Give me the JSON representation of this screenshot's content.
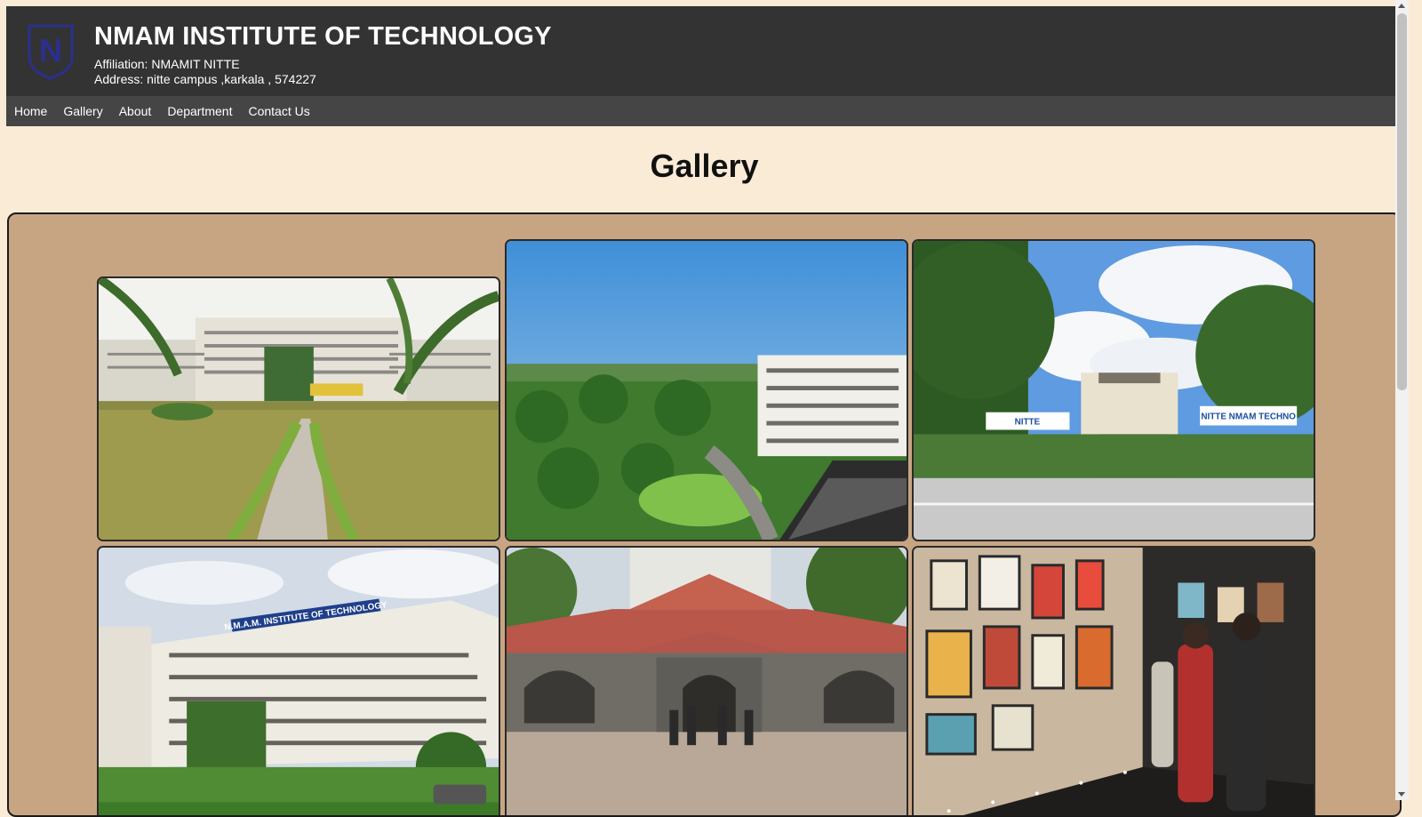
{
  "header": {
    "title": "NMAM INSTITUTE OF TECHNOLOGY",
    "affiliation": "Affiliation: NMAMIT NITTE",
    "address": "Address: nitte campus ,karkala , 574227",
    "logo_letter": "N",
    "background": "#333333"
  },
  "nav": {
    "items": [
      "Home",
      "Gallery",
      "About",
      "Department",
      "Contact Us"
    ],
    "background": "#454545"
  },
  "main": {
    "heading": "Gallery",
    "page_background": "#faebd7",
    "gallery_background": "#c8a582"
  },
  "gallery": {
    "photos": [
      {
        "subject": "campus-garden-path",
        "signs": []
      },
      {
        "subject": "aerial-campus-view",
        "signs": []
      },
      {
        "subject": "campus-entrance-steps",
        "signs": [
          "NITTE",
          "NITTE NMAM TECHNO"
        ]
      },
      {
        "subject": "main-building-front",
        "signs": [
          "N.M.A.M. INSTITUTE OF TECHNOLOGY"
        ]
      },
      {
        "subject": "heritage-building-group",
        "signs": []
      },
      {
        "subject": "art-exhibition",
        "signs": []
      }
    ]
  }
}
